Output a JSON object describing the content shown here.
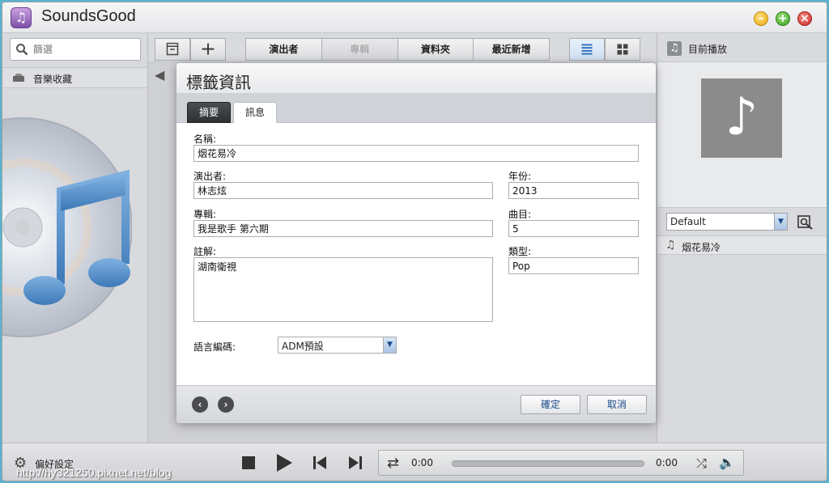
{
  "app": {
    "title": "SoundsGood",
    "accent_color": "#7d4fa8",
    "watermark": "http://hy321250.pixnet.net/blog"
  },
  "left": {
    "filter_placeholder": "篩選",
    "library_label": "音樂收藏"
  },
  "toolbar": {
    "tabs": [
      "演出者",
      "專輯",
      "資料夾",
      "最近新增"
    ],
    "active_tab": "專輯",
    "view_list_icon": "list-view-icon",
    "view_grid_icon": "grid-view-icon"
  },
  "right": {
    "now_playing_label": "目前播放",
    "playlist_selected": "Default",
    "tracks": [
      {
        "title": "烟花易冷"
      }
    ]
  },
  "player": {
    "preferences_label": "偏好設定",
    "time_elapsed": "0:00",
    "time_total": "0:00"
  },
  "dialog": {
    "title": "標籤資訊",
    "tabs": {
      "summary": "摘要",
      "info": "訊息"
    },
    "active_tab": "訊息",
    "fields": {
      "name_label": "名稱:",
      "name_value": "烟花易冷",
      "artist_label": "演出者:",
      "artist_value": "林志炫",
      "year_label": "年份:",
      "year_value": "2013",
      "album_label": "專輯:",
      "album_value": "我是歌手 第六期",
      "track_label": "曲目:",
      "track_value": "5",
      "comment_label": "註解:",
      "comment_value": "湖南衛視",
      "genre_label": "類型:",
      "genre_value": "Pop",
      "encoding_label": "語言編碼:",
      "encoding_value": "ADM預設"
    },
    "buttons": {
      "ok": "確定",
      "cancel": "取消"
    }
  }
}
